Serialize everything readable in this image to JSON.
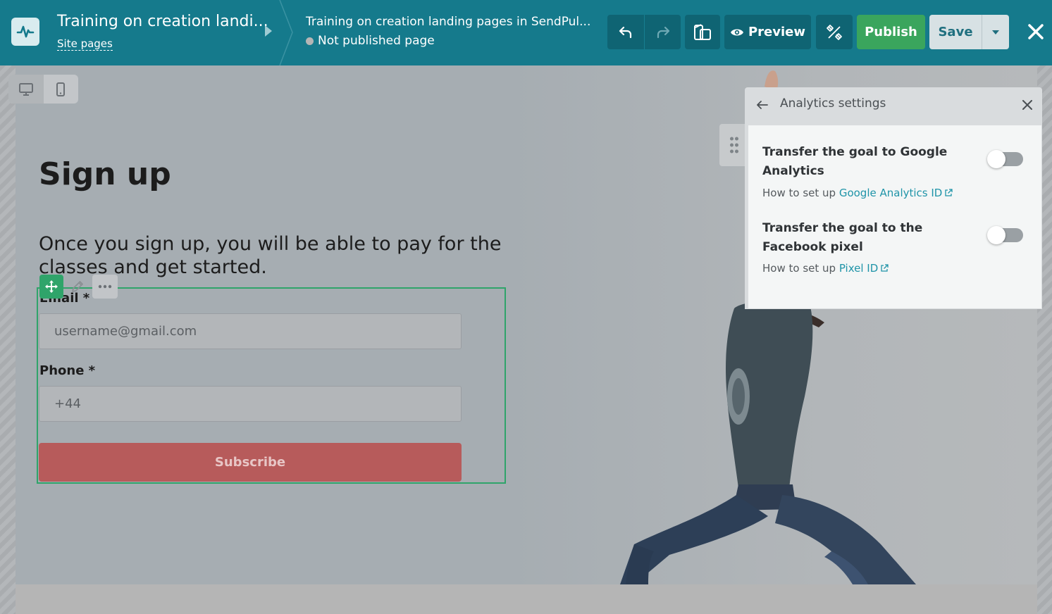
{
  "header": {
    "site_title": "Training on creation landi...",
    "site_pages_link": "Site pages",
    "page_name": "Training on creation landing pages in SendPul...",
    "page_status": "Not published page",
    "preview_label": "Preview",
    "publish_label": "Publish",
    "save_label": "Save"
  },
  "page": {
    "title": "Sign up",
    "description": "Once you sign up, you will be able to pay for the classes and get started.",
    "form": {
      "email_label": "Email *",
      "email_placeholder": "username@gmail.com",
      "phone_label": "Phone *",
      "phone_placeholder": "+44",
      "submit_label": "Subscribe"
    }
  },
  "analytics_panel": {
    "title": "Analytics settings",
    "options": [
      {
        "title": "Transfer the goal to Google Analytics",
        "help_prefix": "How to set up",
        "help_link": "Google Analytics ID",
        "enabled": false
      },
      {
        "title": "Transfer the goal to the Facebook pixel",
        "help_prefix": "How to set up",
        "help_link": "Pixel ID",
        "enabled": false
      }
    ]
  },
  "colors": {
    "topbar": "#157a8c",
    "publish": "#3aa55d",
    "subscribe": "#b75b5b",
    "selection": "#2fa46a",
    "link": "#1f94a8"
  },
  "icons": [
    "logo-icon",
    "caret-right-icon",
    "undo-icon",
    "redo-icon",
    "mobile-preview-icon",
    "eye-icon",
    "tools-icon",
    "caret-down-icon",
    "close-icon",
    "desktop-icon",
    "mobile-icon",
    "move-icon",
    "pencil-icon",
    "more-icon",
    "drag-handle-icon",
    "back-arrow-icon",
    "external-link-icon"
  ]
}
